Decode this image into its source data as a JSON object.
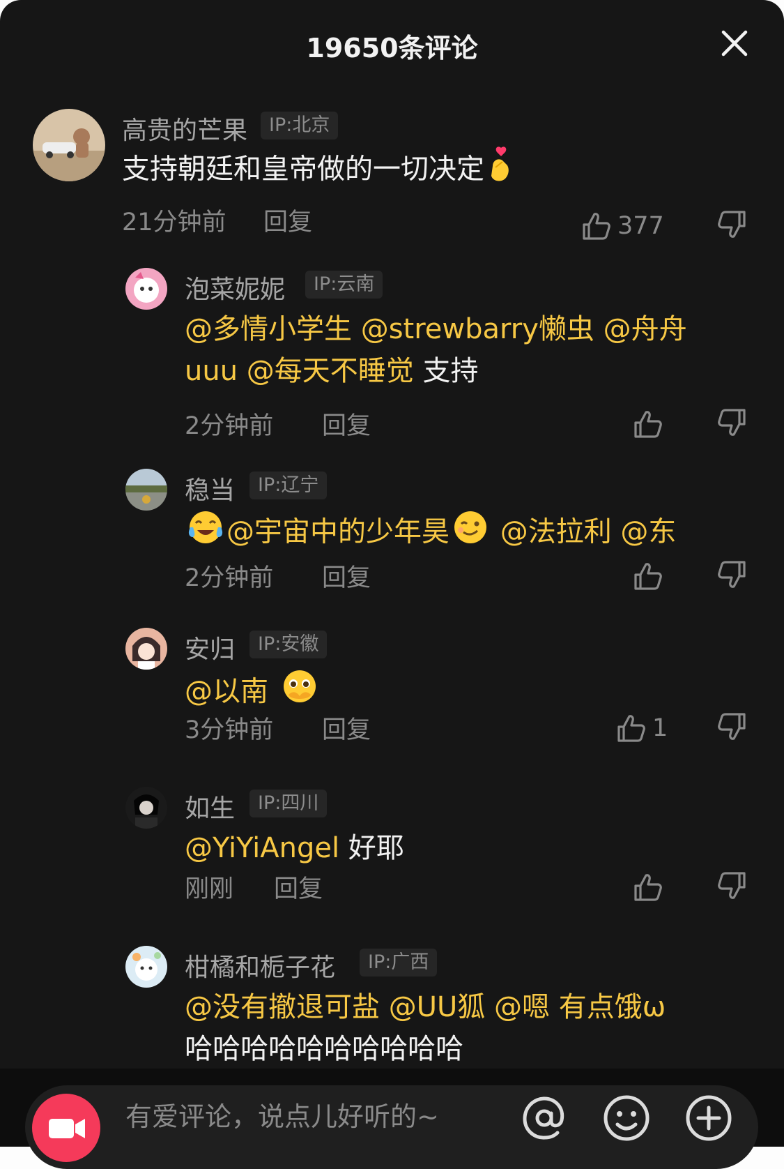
{
  "header": {
    "title": "19650条评论"
  },
  "comments": [
    {
      "username": "高贵的芒果",
      "ip": "IP:北京",
      "text": "支持朝廷和皇帝做的一切决定",
      "emoji": "finger-heart",
      "time": "21分钟前",
      "reply": "回复",
      "likes": "377"
    },
    {
      "username": "泡菜妮妮",
      "ip": "IP:云南",
      "line1_mentions": "@多情小学生 @strewbarry懒虫 @舟舟",
      "line2_mentions": "uuu @每天不睡觉",
      "line2_text": " 支持",
      "time": "2分钟前",
      "reply": "回复",
      "likes": ""
    },
    {
      "username": "稳当",
      "ip": "IP:辽宁",
      "emoji1": "tears-of-joy",
      "mention1": "@宇宙中的少年昊",
      "emoji2": "wink",
      "mention2": " @法拉利 @东",
      "time": "2分钟前",
      "reply": "回复",
      "likes": ""
    },
    {
      "username": "安归",
      "ip": "IP:安徽",
      "mention": "@以南",
      "emoji": "pleading-hands",
      "time": "3分钟前",
      "reply": "回复",
      "likes": "1"
    },
    {
      "username": "如生",
      "ip": "IP:四川",
      "mention": "@YiYiAngel",
      "text": " 好耶",
      "time": "刚刚",
      "reply": "回复",
      "likes": ""
    },
    {
      "username": "柑橘和栀子花",
      "ip": "IP:广西",
      "line1_mentions": "@没有撤退可盐 @UU狐 @嗯 有点饿ω",
      "line2_text": "哈哈哈哈哈哈哈哈哈哈"
    }
  ],
  "input": {
    "placeholder": "有爱评论，说点儿好听的~"
  },
  "colors": {
    "mention": "#f7c845",
    "background": "#161616",
    "camera": "#f53a5a"
  }
}
